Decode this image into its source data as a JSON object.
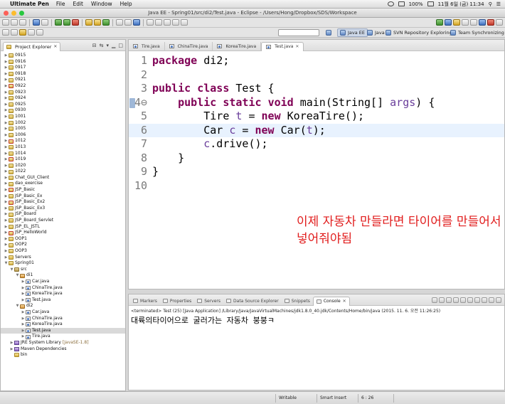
{
  "menubar": {
    "app_name": "Ultimate Pen",
    "items": [
      "File",
      "Edit",
      "Window",
      "Help"
    ],
    "battery": "100%",
    "clock": "11월 6일 (금)  11:34"
  },
  "window": {
    "title": "Java EE - Spring01/src/di2/Test.java - Eclipse - /Users/Hong/Dropbox/SDS/Workspace"
  },
  "perspectives": [
    "Java EE",
    "Java",
    "SVN Repository Exploring",
    "Team Synchronizing"
  ],
  "explorer": {
    "title": "Project Explorer",
    "items": [
      {
        "label": "0915",
        "depth": 0,
        "icon": "proj",
        "tw": "▶"
      },
      {
        "label": "0916",
        "depth": 0,
        "icon": "proj",
        "tw": "▶"
      },
      {
        "label": "0917",
        "depth": 0,
        "icon": "proj",
        "tw": "▶"
      },
      {
        "label": "0918",
        "depth": 0,
        "icon": "proj",
        "tw": "▶"
      },
      {
        "label": "0921",
        "depth": 0,
        "icon": "proj",
        "tw": "▶"
      },
      {
        "label": "0922",
        "depth": 0,
        "icon": "projx",
        "tw": "▶"
      },
      {
        "label": "0923",
        "depth": 0,
        "icon": "proj",
        "tw": "▶"
      },
      {
        "label": "0924",
        "depth": 0,
        "icon": "proj",
        "tw": "▶"
      },
      {
        "label": "0925",
        "depth": 0,
        "icon": "proj",
        "tw": "▶"
      },
      {
        "label": "0930",
        "depth": 0,
        "icon": "proj",
        "tw": "▶"
      },
      {
        "label": "1001",
        "depth": 0,
        "icon": "proj",
        "tw": "▶"
      },
      {
        "label": "1002",
        "depth": 0,
        "icon": "proj",
        "tw": "▶"
      },
      {
        "label": "1005",
        "depth": 0,
        "icon": "proj",
        "tw": "▶"
      },
      {
        "label": "1006",
        "depth": 0,
        "icon": "proj",
        "tw": "▶"
      },
      {
        "label": "1012",
        "depth": 0,
        "icon": "projx",
        "tw": "▶"
      },
      {
        "label": "1013",
        "depth": 0,
        "icon": "proj",
        "tw": "▶"
      },
      {
        "label": "1014",
        "depth": 0,
        "icon": "proj",
        "tw": "▶"
      },
      {
        "label": "1019",
        "depth": 0,
        "icon": "projx",
        "tw": "▶"
      },
      {
        "label": "1020",
        "depth": 0,
        "icon": "proj",
        "tw": "▶"
      },
      {
        "label": "1022",
        "depth": 0,
        "icon": "proj",
        "tw": "▶"
      },
      {
        "label": "Chat_GUI_Client",
        "depth": 0,
        "icon": "proj",
        "tw": "▶"
      },
      {
        "label": "dao_exercise",
        "depth": 0,
        "icon": "proj",
        "tw": "▶"
      },
      {
        "label": "JSP_Basic",
        "depth": 0,
        "icon": "projx",
        "tw": "▶"
      },
      {
        "label": "JSP_Basic_Ex",
        "depth": 0,
        "icon": "proj",
        "tw": "▶"
      },
      {
        "label": "JSP_Basic_Ex2",
        "depth": 0,
        "icon": "projx",
        "tw": "▶"
      },
      {
        "label": "JSP_Basic_Ex3",
        "depth": 0,
        "icon": "proj",
        "tw": "▶"
      },
      {
        "label": "JSP_Board",
        "depth": 0,
        "icon": "proj",
        "tw": "▶"
      },
      {
        "label": "JSP_Board_Servlet",
        "depth": 0,
        "icon": "proj",
        "tw": "▶"
      },
      {
        "label": "JSP_EL_JSTL",
        "depth": 0,
        "icon": "proj",
        "tw": "▶"
      },
      {
        "label": "JSP_HelloWorld",
        "depth": 0,
        "icon": "projx",
        "tw": "▶"
      },
      {
        "label": "OOP1",
        "depth": 0,
        "icon": "proj",
        "tw": "▶"
      },
      {
        "label": "OOP2",
        "depth": 0,
        "icon": "proj",
        "tw": "▶"
      },
      {
        "label": "OOP3",
        "depth": 0,
        "icon": "proj",
        "tw": "▶"
      },
      {
        "label": "Servers",
        "depth": 0,
        "icon": "folder",
        "tw": "▶"
      },
      {
        "label": "Spring01",
        "depth": 0,
        "icon": "proj",
        "tw": "▼"
      },
      {
        "label": "src",
        "depth": 1,
        "icon": "src",
        "tw": "▼"
      },
      {
        "label": "di1",
        "depth": 2,
        "icon": "pkg",
        "tw": "▼"
      },
      {
        "label": "Car.java",
        "depth": 3,
        "icon": "java",
        "tw": "▶"
      },
      {
        "label": "ChinaTire.java",
        "depth": 3,
        "icon": "java",
        "tw": "▶"
      },
      {
        "label": "KoreaTire.java",
        "depth": 3,
        "icon": "java",
        "tw": "▶"
      },
      {
        "label": "Test.java",
        "depth": 3,
        "icon": "java",
        "tw": "▶"
      },
      {
        "label": "di2",
        "depth": 2,
        "icon": "pkg",
        "tw": "▼"
      },
      {
        "label": "Car.java",
        "depth": 3,
        "icon": "java",
        "tw": "▶"
      },
      {
        "label": "ChinaTire.java",
        "depth": 3,
        "icon": "java",
        "tw": "▶"
      },
      {
        "label": "KoreaTire.java",
        "depth": 3,
        "icon": "java",
        "tw": "▶"
      },
      {
        "label": "Test.java",
        "depth": 3,
        "icon": "java",
        "tw": "▶",
        "selected": true
      },
      {
        "label": "Tire.java",
        "depth": 3,
        "icon": "java",
        "tw": "▶"
      },
      {
        "label": "JRE System Library",
        "depth": 1,
        "icon": "lib",
        "tw": "▶",
        "tag": "[JavaSE-1.8]"
      },
      {
        "label": "Maven Dependencies",
        "depth": 1,
        "icon": "lib",
        "tw": "▶"
      },
      {
        "label": "bin",
        "depth": 1,
        "icon": "folder",
        "tw": ""
      }
    ]
  },
  "editor": {
    "tabs": [
      {
        "label": "Tire.java",
        "active": false
      },
      {
        "label": "ChinaTire.java",
        "active": false
      },
      {
        "label": "KoreaTire.java",
        "active": false
      },
      {
        "label": "Test.java",
        "active": true
      }
    ],
    "lines": [
      {
        "n": "1",
        "html": "<span class='kw'>package</span> di2;"
      },
      {
        "n": "2",
        "html": ""
      },
      {
        "n": "3",
        "html": "<span class='kw'>public</span> <span class='kw'>class</span> Test {"
      },
      {
        "n": "4⊖",
        "html": "    <span class='kw'>public</span> <span class='kw'>static</span> <span class='kw'>void</span> main(String[] <span class='param'>args</span>) {"
      },
      {
        "n": "5",
        "html": "        Tire <span class='local'>t</span> = <span class='kw'>new</span> KoreaTire();"
      },
      {
        "n": "6",
        "html": "        Car <span class='local'>c</span> = <span class='kw'>new</span> Car(<span class='local'>t</span>);",
        "hl": true
      },
      {
        "n": "7",
        "html": "        <span class='local'>c</span>.drive();"
      },
      {
        "n": "8",
        "html": "    }"
      },
      {
        "n": "9",
        "html": "}"
      },
      {
        "n": "10",
        "html": ""
      }
    ],
    "annotation_line1": "이제 자동차 만들라면 타이어를 만들어서",
    "annotation_line2": "넣어줘야됨",
    "annotation_color": "#e11d1d"
  },
  "console": {
    "tabs": [
      "Markers",
      "Properties",
      "Servers",
      "Data Source Explorer",
      "Snippets",
      "Console"
    ],
    "active_tab": "Console",
    "terminated_line": "<terminated> Test (25) [Java Application] /Library/Java/JavaVirtualMachines/jdk1.8.0_40.jdk/Contents/Home/bin/java (2015. 11. 6. 오전 11:26:25)",
    "output": "대륙의타이어으로 굴러가는 자동차 붕붕ㅋ"
  },
  "statusbar": {
    "writable": "Writable",
    "insert_mode": "Smart Insert",
    "position": "6 : 26"
  }
}
